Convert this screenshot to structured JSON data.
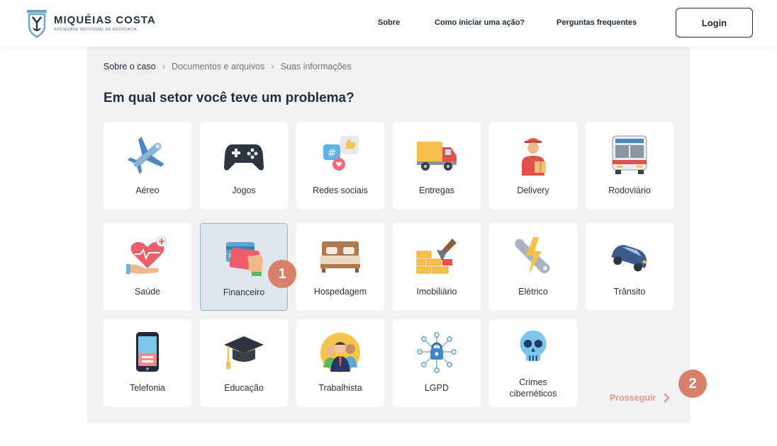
{
  "header": {
    "logo_name": "MIQUÉIAS COSTA",
    "logo_subtitle": "SOCIEDADE INDIVIDUAL DE ADVOCACIA",
    "nav": [
      "Sobre",
      "Como iniciar uma ação?",
      "Perguntas frequentes"
    ],
    "login_label": "Login"
  },
  "breadcrumb": [
    "Sobre o caso",
    "Documentos e arquivos",
    "Suas informações"
  ],
  "question": "Em qual setor você teve um problema?",
  "sectors": [
    {
      "label": "Aéreo",
      "icon": "airplane-icon"
    },
    {
      "label": "Jogos",
      "icon": "gamepad-icon"
    },
    {
      "label": "Redes sociais",
      "icon": "social-media-icon"
    },
    {
      "label": "Entregas",
      "icon": "truck-icon"
    },
    {
      "label": "Delivery",
      "icon": "delivery-person-icon"
    },
    {
      "label": "Rodoviário",
      "icon": "bus-icon"
    },
    {
      "label": "Saúde",
      "icon": "health-heart-icon"
    },
    {
      "label": "Financeiro",
      "icon": "credit-card-icon",
      "selected": true
    },
    {
      "label": "Hospedagem",
      "icon": "bed-icon"
    },
    {
      "label": "Imobiliário",
      "icon": "bricks-trowel-icon"
    },
    {
      "label": "Elétrico",
      "icon": "wrench-lightning-icon"
    },
    {
      "label": "Trânsito",
      "icon": "car-crash-icon"
    },
    {
      "label": "Telefonia",
      "icon": "smartphone-icon"
    },
    {
      "label": "Educação",
      "icon": "graduation-cap-icon"
    },
    {
      "label": "Trabalhista",
      "icon": "workers-icon"
    },
    {
      "label": "LGPD",
      "icon": "data-lock-icon"
    },
    {
      "label": "Crimes cibernéticos",
      "icon": "skull-icon"
    }
  ],
  "badges": [
    "1",
    "2"
  ],
  "proceed_label": "Prosseguir",
  "colors": {
    "accent": "#d9806a",
    "selected_bg": "#dfe6ec",
    "selected_border": "#8fb3cb",
    "proceed": "#e49a84"
  }
}
